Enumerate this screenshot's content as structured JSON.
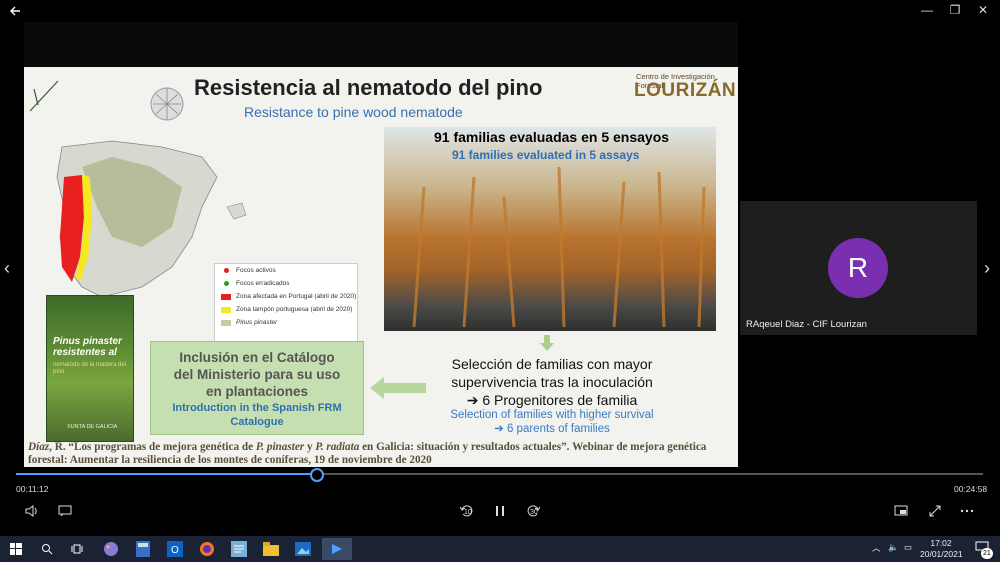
{
  "window": {
    "back": "←",
    "minimize": "—",
    "maximize": "❐",
    "close": "✕"
  },
  "slide": {
    "title": "Resistencia al nematodo del pino",
    "subtitle": "Resistance to pine wood nematode",
    "logo_small": "Centro de Investigación Forestal",
    "logo_big": "LOURIZÁN",
    "legend": [
      {
        "label": "Focos activos",
        "color": "#e02020",
        "kind": "dot"
      },
      {
        "label": "Focos erradicados",
        "color": "#2aa02a",
        "kind": "dot"
      },
      {
        "label": "Zona afectada en Portugal (abril de 2020)",
        "color": "#e82020",
        "kind": "swatch"
      },
      {
        "label": "Zona tampón portuguesa (abril de 2020)",
        "color": "#f5e81e",
        "kind": "swatch"
      },
      {
        "label": "Pinus pinaster",
        "color": "#c8caa0",
        "kind": "swatch"
      }
    ],
    "book": {
      "title_line1": "Pinus pinaster",
      "title_line2": "resistentes al",
      "sub": "nematodo de la madera del pino",
      "foot": "XUNTA DE GALICIA"
    },
    "photo_h1": "91 familias evaluadas en 5 ensayos",
    "photo_h2": "91 families evaluated in 5 assays",
    "green_box": {
      "es_1": "Inclusión en el Catálogo",
      "es_2": "del Ministerio para su uso",
      "es_3": "en plantaciones",
      "en_1": "Introduction in the Spanish FRM",
      "en_2": "Catalogue"
    },
    "selection_es_1": "Selección de familias con mayor",
    "selection_es_2": "supervivencia tras la inoculación",
    "selection_es_3": "➔ 6 Progenitores de familia",
    "selection_en_1": "Selection of families with higher survival",
    "selection_en_2": "➔ 6 parents of families",
    "citation_author": "Díaz",
    "citation_pre": ", R. “Los programas de mejora genética de ",
    "citation_sp1": "P. pinaster",
    "citation_mid": " y ",
    "citation_sp2": "P. radiata",
    "citation_post": " en Galicia: situación y resultados actuales”. Webinar de mejora genética forestal: Aumentar la resiliencia de los montes de coníferas, 19 de noviembre de 2020"
  },
  "participant": {
    "initial": "R",
    "name": "RAqeuel Diaz - CIF Lourizan"
  },
  "player": {
    "elapsed": "00:11:12",
    "total": "00:24:58",
    "progress": 0.31,
    "rewind_label": "10",
    "forward_label": "30"
  },
  "taskbar": {
    "time": "17:02",
    "date": "20/01/2021",
    "notif": "21"
  },
  "colors": {
    "accent": "#4da3ff",
    "taskbar": "#1a2233",
    "avatar": "#7a2fb0"
  }
}
